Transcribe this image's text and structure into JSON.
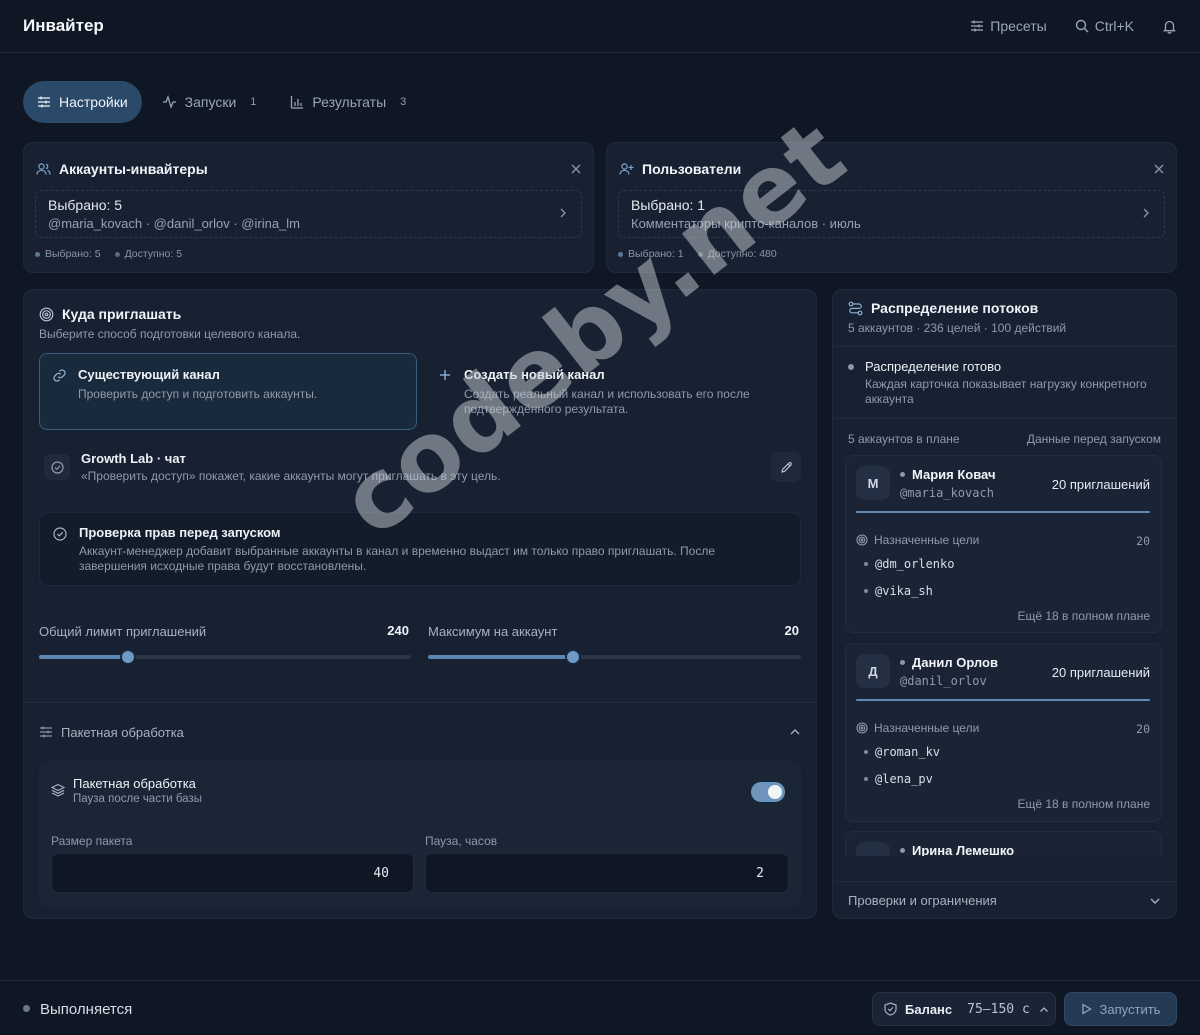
{
  "app": {
    "title": "Инвайтер"
  },
  "topbar": {
    "presets_label": "Пресеты",
    "search_shortcut": "Ctrl+K"
  },
  "tabs": [
    {
      "label": "Настройки",
      "active": true,
      "count": ""
    },
    {
      "label": "Запуски",
      "active": false,
      "count": "1"
    },
    {
      "label": "Результаты",
      "active": false,
      "count": "3"
    }
  ],
  "accounts_panel": {
    "title": "Аккаунты-инвайтеры",
    "selected_line": "Выбрано: 5",
    "selected_items": "@maria_kovach · @danil_orlov · @irina_lm",
    "stat_selected": "Выбрано: 5",
    "stat_available": "Доступно: 5"
  },
  "users_panel": {
    "title": "Пользователи",
    "selected_line": "Выбрано: 1",
    "selected_items": "Комментаторы крипто-каналов · июль",
    "stat_selected": "Выбрано: 1",
    "stat_available": "Доступно: 480"
  },
  "target": {
    "title": "Куда приглашать",
    "subtitle": "Выберите способ подготовки целевого канала.",
    "options": [
      {
        "title": "Существующий канал",
        "desc": "Проверить доступ и подготовить аккаунты.",
        "selected": true
      },
      {
        "title": "Создать новый канал",
        "desc": "Создать реальный канал и использовать его после подтверждённого результата.",
        "selected": false
      }
    ],
    "channel_name": "Growth Lab · чат",
    "channel_hint": "«Проверить доступ» покажет, какие аккаунты могут приглашать в эту цель.",
    "rights_title": "Проверка прав перед запуском",
    "rights_desc": "Аккаунт-менеджер добавит выбранные аккаунты в канал и временно выдаст им только право приглашать. После завершения исходные права будут восстановлены."
  },
  "limits": {
    "total_label": "Общий лимит приглашений",
    "total_value": "240",
    "total_fraction": 0.24,
    "per_account_label": "Максимум на аккаунт",
    "per_account_value": "20",
    "per_account_fraction": 0.39
  },
  "batch": {
    "section_label": "Пакетная обработка",
    "title": "Пакетная обработка",
    "subtitle": "Пауза после части базы",
    "enabled": true,
    "size_label": "Размер пакета",
    "size_value": "40",
    "pause_label": "Пауза, часов",
    "pause_value": "2"
  },
  "distribution": {
    "title": "Распределение потоков",
    "summary": "5 аккаунтов · 236 целей · 100 действий",
    "ready_title": "Распределение готово",
    "ready_desc": "Каждая карточка показывает нагрузку конкретного аккаунта",
    "accounts_count": "5 аккаунтов в плане",
    "data_label": "Данные перед запуском",
    "goals_label": "Назначенные цели",
    "accounts": [
      {
        "initial": "М",
        "name": "Мария Ковач",
        "handle": "@maria_kovach",
        "invites": "20 приглашений",
        "goals_count": "20",
        "goals": [
          "@dm_orlenko",
          "@vika_sh"
        ],
        "more": "Ещё 18 в полном плане"
      },
      {
        "initial": "Д",
        "name": "Данил Орлов",
        "handle": "@danil_orlov",
        "invites": "20 приглашений",
        "goals_count": "20",
        "goals": [
          "@roman_kv",
          "@lena_pv"
        ],
        "more": "Ещё 18 в полном плане"
      },
      {
        "initial": "И",
        "name": "Ирина Лемешко",
        "handle": "",
        "invites": "",
        "goals_count": "",
        "goals": [],
        "more": ""
      }
    ],
    "checks_label": "Проверки и ограничения"
  },
  "footer": {
    "status": "Выполняется",
    "balance_label": "Баланс",
    "balance_value": "75–150 с",
    "run_label": "Запустить"
  },
  "watermark": "codeby.net"
}
